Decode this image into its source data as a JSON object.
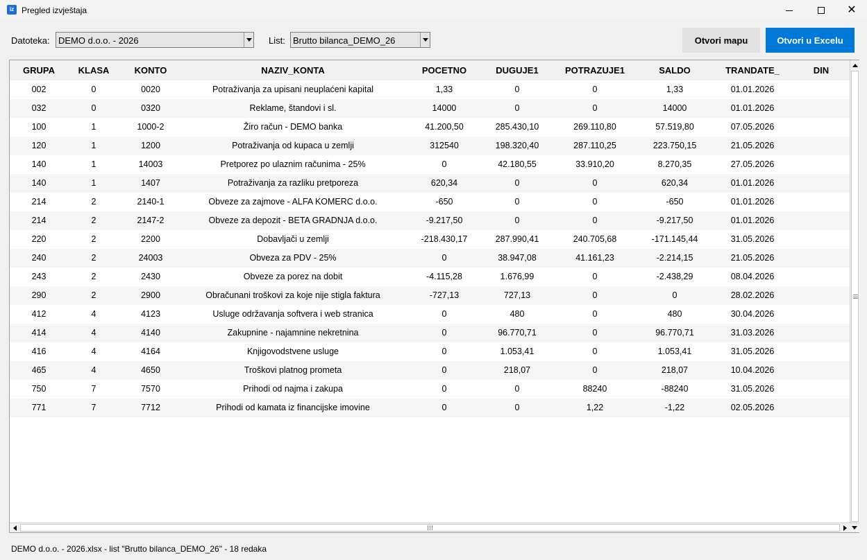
{
  "window": {
    "title": "Pregled izvještaja",
    "icon_text": "iz",
    "close_glyph": "✕"
  },
  "toolbar": {
    "file_label": "Datoteka:",
    "file_value": "DEMO d.o.o. - 2026",
    "list_label": "List:",
    "list_value": "Brutto bilanca_DEMO_26",
    "open_folder_label": "Otvori mapu",
    "open_excel_label": "Otvori u Excelu"
  },
  "table": {
    "columns": [
      "GRUPA",
      "KLASA",
      "KONTO",
      "NAZIV_KONTA",
      "POCETNO",
      "DUGUJE1",
      "POTRAZUJE1",
      "SALDO",
      "TRANDATE_",
      "DIN"
    ],
    "rows": [
      [
        "002",
        "0",
        "0020",
        "Potraživanja za upisani neuplaćeni kapital",
        "1,33",
        "0",
        "0",
        "1,33",
        "01.01.2026",
        ""
      ],
      [
        "032",
        "0",
        "0320",
        "Reklame, štandovi i sl.",
        "14000",
        "0",
        "0",
        "14000",
        "01.01.2026",
        ""
      ],
      [
        "100",
        "1",
        "1000-2",
        "Žiro račun - DEMO banka",
        "41.200,50",
        "285.430,10",
        "269.110,80",
        "57.519,80",
        "07.05.2026",
        ""
      ],
      [
        "120",
        "1",
        "1200",
        "Potraživanja od kupaca u zemlji",
        "312540",
        "198.320,40",
        "287.110,25",
        "223.750,15",
        "21.05.2026",
        ""
      ],
      [
        "140",
        "1",
        "14003",
        "Pretporez po ulaznim računima - 25%",
        "0",
        "42.180,55",
        "33.910,20",
        "8.270,35",
        "27.05.2026",
        ""
      ],
      [
        "140",
        "1",
        "1407",
        "Potraživanja za razliku pretporeza",
        "620,34",
        "0",
        "0",
        "620,34",
        "01.01.2026",
        ""
      ],
      [
        "214",
        "2",
        "2140-1",
        "Obveze za zajmove - ALFA KOMERC d.o.o.",
        "-650",
        "0",
        "0",
        "-650",
        "01.01.2026",
        ""
      ],
      [
        "214",
        "2",
        "2147-2",
        "Obveze za depozit - BETA GRADNJA d.o.o.",
        "-9.217,50",
        "0",
        "0",
        "-9.217,50",
        "01.01.2026",
        ""
      ],
      [
        "220",
        "2",
        "2200",
        "Dobavljači u zemlji",
        "-218.430,17",
        "287.990,41",
        "240.705,68",
        "-171.145,44",
        "31.05.2026",
        ""
      ],
      [
        "240",
        "2",
        "24003",
        "Obveza za PDV - 25%",
        "0",
        "38.947,08",
        "41.161,23",
        "-2.214,15",
        "21.05.2026",
        ""
      ],
      [
        "243",
        "2",
        "2430",
        "Obveze za porez na dobit",
        "-4.115,28",
        "1.676,99",
        "0",
        "-2.438,29",
        "08.04.2026",
        ""
      ],
      [
        "290",
        "2",
        "2900",
        "Obračunani troškovi za koje nije stigla faktura",
        "-727,13",
        "727,13",
        "0",
        "0",
        "28.02.2026",
        ""
      ],
      [
        "412",
        "4",
        "4123",
        "Usluge održavanja softvera i web stranica",
        "0",
        "480",
        "0",
        "480",
        "30.04.2026",
        ""
      ],
      [
        "414",
        "4",
        "4140",
        "Zakupnine - najamnine nekretnina",
        "0",
        "96.770,71",
        "0",
        "96.770,71",
        "31.03.2026",
        ""
      ],
      [
        "416",
        "4",
        "4164",
        "Knjigovodstvene usluge",
        "0",
        "1.053,41",
        "0",
        "1.053,41",
        "31.05.2026",
        ""
      ],
      [
        "465",
        "4",
        "4650",
        "Troškovi platnog prometa",
        "0",
        "218,07",
        "0",
        "218,07",
        "10.04.2026",
        ""
      ],
      [
        "750",
        "7",
        "7570",
        "Prihodi od najma i zakupa",
        "0",
        "0",
        "88240",
        "-88240",
        "31.05.2026",
        ""
      ],
      [
        "771",
        "7",
        "7712",
        "Prihodi od kamata iz financijske imovine",
        "0",
        "0",
        "1,22",
        "-1,22",
        "02.05.2026",
        ""
      ]
    ]
  },
  "status": {
    "text": "DEMO d.o.o. - 2026.xlsx  -  list \"Brutto bilanca_DEMO_26\"  -  18 redaka"
  },
  "colors": {
    "accent": "#0078d7",
    "row_alt": "#f5f5f5",
    "header_bg": "#f0f0f0"
  },
  "icons": [
    "app-icon",
    "minimize-icon",
    "maximize-icon",
    "close-icon",
    "dropdown-arrow-icon",
    "scroll-arrow-icon"
  ]
}
